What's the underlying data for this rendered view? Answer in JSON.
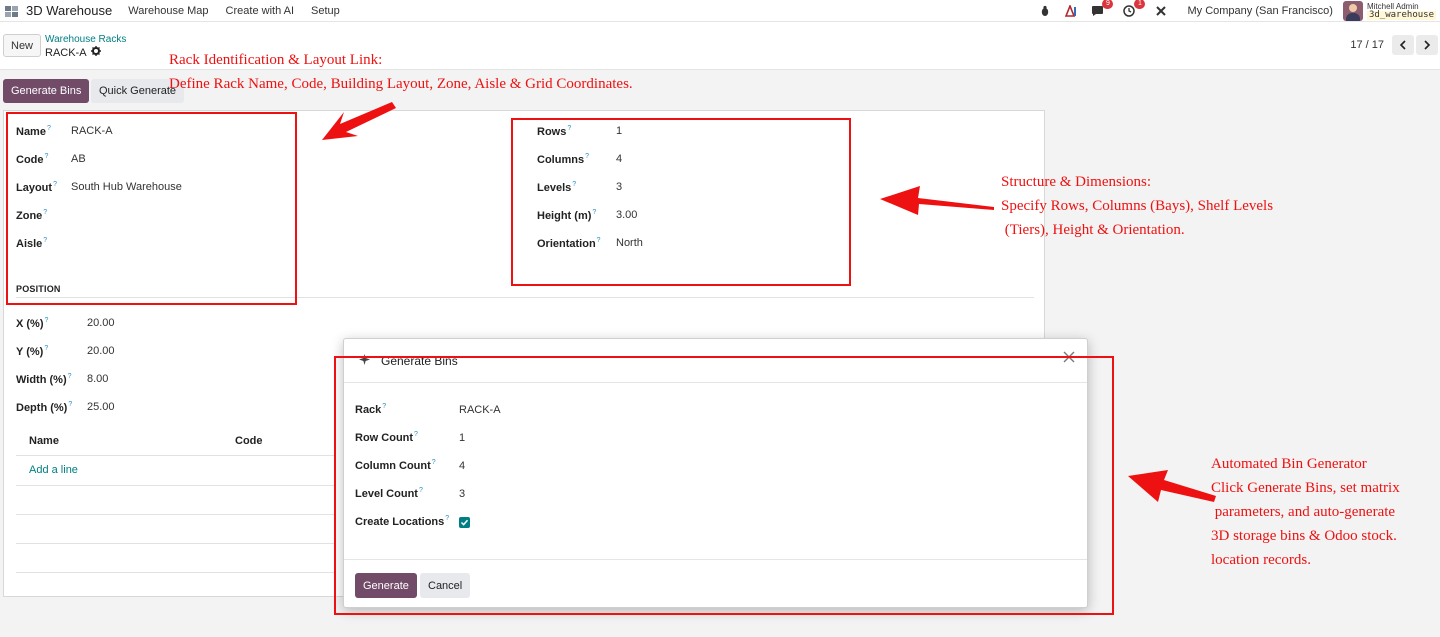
{
  "navbar": {
    "app_name": "3D Warehouse",
    "menus": [
      "Warehouse Map",
      "Create with AI",
      "Setup"
    ],
    "chat_badge": "9",
    "activity_badge": "1",
    "company": "My Company (San Francisco)",
    "user_name": "Mitchell Admin",
    "database": "3d_warehouse"
  },
  "control_panel": {
    "new_label": "New",
    "breadcrumb_parent": "Warehouse Racks",
    "record_title": "RACK-A",
    "pager": "17 / 17"
  },
  "statusbar": {
    "generate_bins_label": "Generate Bins",
    "quick_generate_label": "Quick Generate"
  },
  "form": {
    "left": {
      "name": {
        "label": "Name",
        "value": "RACK-A"
      },
      "code": {
        "label": "Code",
        "value": "AB"
      },
      "layout": {
        "label": "Layout",
        "value": "South Hub Warehouse"
      },
      "zone": {
        "label": "Zone",
        "value": ""
      },
      "aisle": {
        "label": "Aisle",
        "value": ""
      }
    },
    "right": {
      "rows": {
        "label": "Rows",
        "value": "1"
      },
      "columns": {
        "label": "Columns",
        "value": "4"
      },
      "levels": {
        "label": "Levels",
        "value": "3"
      },
      "height": {
        "label": "Height (m)",
        "value": "3.00"
      },
      "orientation": {
        "label": "Orientation",
        "value": "North"
      }
    },
    "position_title": "POSITION",
    "position": {
      "x": {
        "label": "X (%)",
        "value": "20.00"
      },
      "y": {
        "label": "Y (%)",
        "value": "20.00"
      },
      "width": {
        "label": "Width (%)",
        "value": "8.00"
      },
      "depth": {
        "label": "Depth (%)",
        "value": "25.00"
      }
    },
    "table": {
      "columns": [
        "Name",
        "Code"
      ],
      "add_line": "Add a line"
    },
    "help_mark": "?"
  },
  "dialog": {
    "title": "Generate Bins",
    "fields": {
      "rack": {
        "label": "Rack",
        "value": "RACK-A"
      },
      "row_count": {
        "label": "Row Count",
        "value": "1"
      },
      "column_count": {
        "label": "Column Count",
        "value": "4"
      },
      "level_count": {
        "label": "Level Count",
        "value": "3"
      },
      "create_locations": {
        "label": "Create Locations",
        "checked": true
      }
    },
    "generate_label": "Generate",
    "cancel_label": "Cancel"
  },
  "annotations": {
    "rack_id": {
      "line1": "Rack Identification & Layout Link:",
      "line2": "Define Rack Name, Code, Building Layout, Zone, Aisle & Grid Coordinates."
    },
    "structure": {
      "line1": "Structure & Dimensions:",
      "line2": "Specify Rows, Columns (Bays), Shelf Levels",
      "line3": " (Tiers), Height & Orientation."
    },
    "bin_generator": {
      "line1": "Automated Bin Generator",
      "line2": "Click Generate Bins, set matrix",
      "line3": " parameters, and auto-generate",
      "line4": "3D storage bins & Odoo stock.",
      "line5": "location records."
    },
    "color": "#ee1111"
  },
  "colors": {
    "primary": "#714b67",
    "link": "#017e84",
    "badge": "#d9363e"
  }
}
